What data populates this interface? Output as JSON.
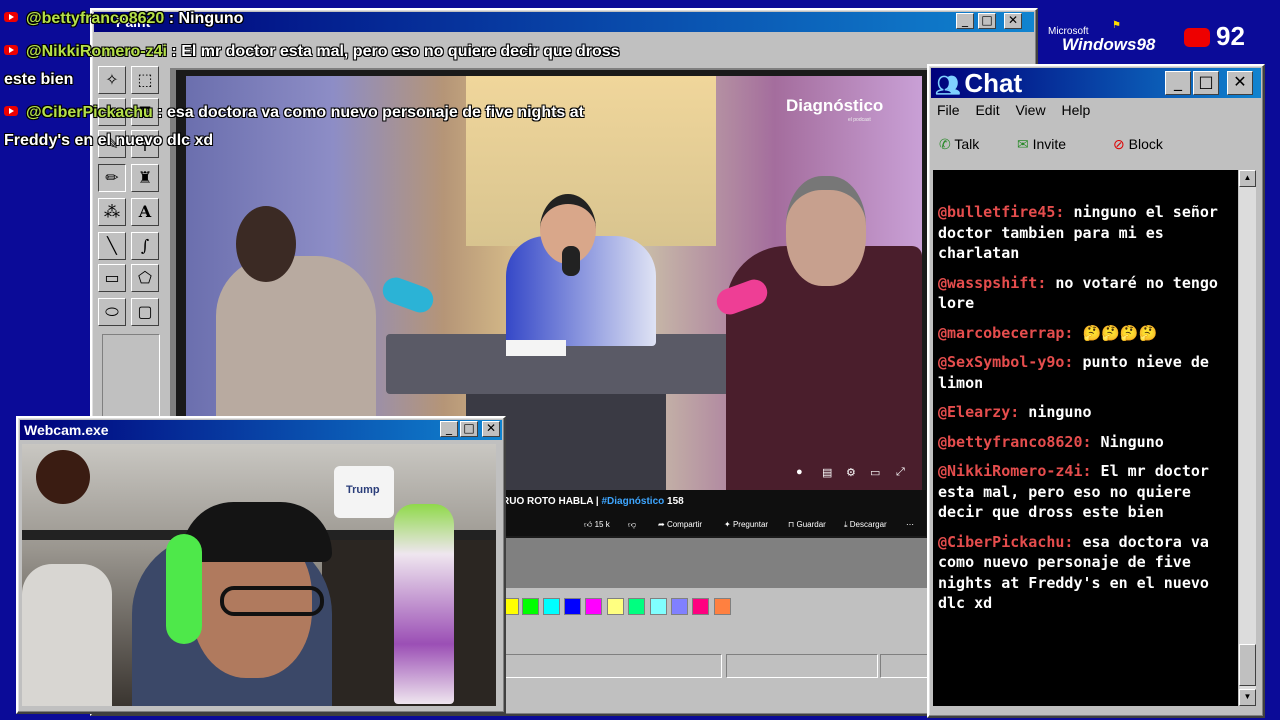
{
  "overlay_chat": [
    {
      "user": "@bettyfranco8620",
      "text": " : Ninguno"
    },
    {
      "user": "@NikkiRomero-z4i",
      "text": " : El mr doctor esta mal, pero eso no quiere decir que dross",
      "cont": "este bien"
    },
    {
      "user": "@CiberPickachu",
      "text": " : esa doctora va como nuevo personaje de five nights at",
      "cont": "Freddy's en el nuevo dlc xd"
    }
  ],
  "paint": {
    "title": "Paint"
  },
  "windows98_logo": {
    "small": "Microsoft",
    "big": "Windows98"
  },
  "viewer_count": "92",
  "video": {
    "brand": "Diagnóstico",
    "brand_sub": "el podcast",
    "title_part": "RUO ROTO HABLA | ",
    "hashtag": "#Diagnóstico",
    "views": " 158",
    "likes": "15 k",
    "share": "Compartir",
    "ask": "Preguntar",
    "save": "Guardar",
    "download": "Descargar",
    "more": "⋯"
  },
  "webcam": {
    "title": "Webcam.exe",
    "poster_text": "Trump"
  },
  "chat_window": {
    "title": "Chat",
    "menu": [
      "File",
      "Edit",
      "View",
      "Help"
    ],
    "actions": [
      "Talk",
      "Invite",
      "Block"
    ],
    "messages": [
      {
        "user": "@bulletfire45:",
        "text": " ninguno el señor doctor tambien para mi es charlatan"
      },
      {
        "user": "@wasspshift:",
        "text": " no votaré no tengo lore"
      },
      {
        "user": "@marcobecerrap:",
        "text": " 🤔🤔🤔🤔"
      },
      {
        "user": "@SexSymbol-y9o:",
        "text": " punto nieve de limon"
      },
      {
        "user": "@Elearzy:",
        "text": " ninguno"
      },
      {
        "user": "@bettyfranco8620:",
        "text": " Ninguno"
      },
      {
        "user": "@NikkiRomero-z4i:",
        "text": " El mr doctor esta mal, pero eso no quiere decir que dross este bien"
      },
      {
        "user": "@CiberPickachu:",
        "text": " esa doctora va como nuevo personaje de five nights at Freddy's en el nuevo dlc xd"
      }
    ]
  },
  "colors": {
    "accent_title": "#00007b",
    "chat_bg": "#000000",
    "desktop": "#0b0b98",
    "username": "#e54d4d",
    "overlay_name": "#b5e04a"
  }
}
